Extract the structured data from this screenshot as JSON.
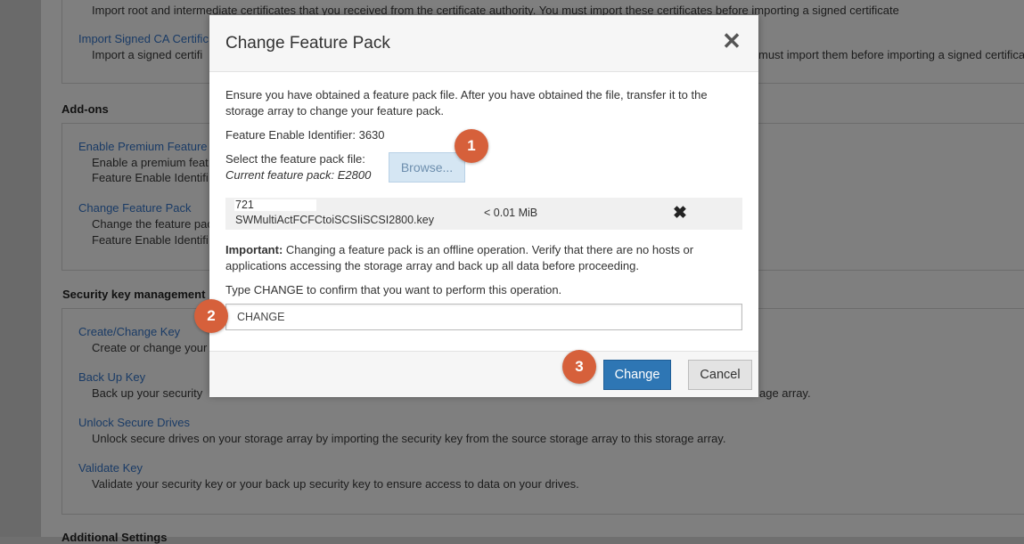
{
  "background": {
    "top_desc_1": "Import root and intermediate certificates that you received from the certificate authority. You must import these certificates before importing a signed certificate",
    "import_signed_link": "Import Signed CA Certific",
    "import_signed_desc_left": "Import a signed certifi",
    "import_signed_desc_right": "must import them before importing a signed certificat",
    "addons_heading": "Add-ons",
    "enable_premium_link": "Enable Premium Feature",
    "enable_premium_desc": "Enable a premium feat",
    "enable_premium_id": "Feature Enable Identifi",
    "change_fp_link": "Change Feature Pack",
    "change_fp_desc": "Change the feature pac",
    "change_fp_id": "Feature Enable Identifi",
    "security_heading": "Security key management",
    "create_key_link": "Create/Change Key",
    "create_key_desc": "Create or change your",
    "backup_key_link": "Back Up Key",
    "backup_key_desc": "Back up your security",
    "backup_key_desc_right": "age array.",
    "unlock_link": "Unlock Secure Drives",
    "unlock_desc": "Unlock secure drives on your storage array by importing the security key from the source storage array to this storage array.",
    "validate_link": "Validate Key",
    "validate_desc": "Validate your security key or your back up security key to ensure access to data on your drives.",
    "additional_heading": "Additional Settings"
  },
  "modal": {
    "title": "Change Feature Pack",
    "intro_line1": "Ensure you have obtained a feature pack file. After you have obtained the file, transfer it to the",
    "intro_line2": "storage array to change your feature pack.",
    "feature_id_label": "Feature Enable Identifier: 3630",
    "select_label": "Select the feature pack file:",
    "current_pack": "Current feature pack: E2800",
    "browse_label": "Browse...",
    "file": {
      "id": "721",
      "name": "SWMultiActFCFCtoiSCSIiSCSI2800.key",
      "size": "< 0.01 MiB"
    },
    "important_label": "Important:",
    "important_text_line1": " Changing a feature pack is an offline operation. Verify that there are no hosts or",
    "important_text_line2": "applications accessing the storage array and back up all data before proceeding.",
    "confirm_prompt": "Type CHANGE to confirm that you want to perform this operation.",
    "confirm_value": "CHANGE",
    "change_button": "Change",
    "cancel_button": "Cancel"
  },
  "callouts": [
    "1",
    "2",
    "3"
  ],
  "colors": {
    "primary": "#2e76b4",
    "callout": "#d6603b",
    "browse_disabled": "#d5e6f3"
  }
}
